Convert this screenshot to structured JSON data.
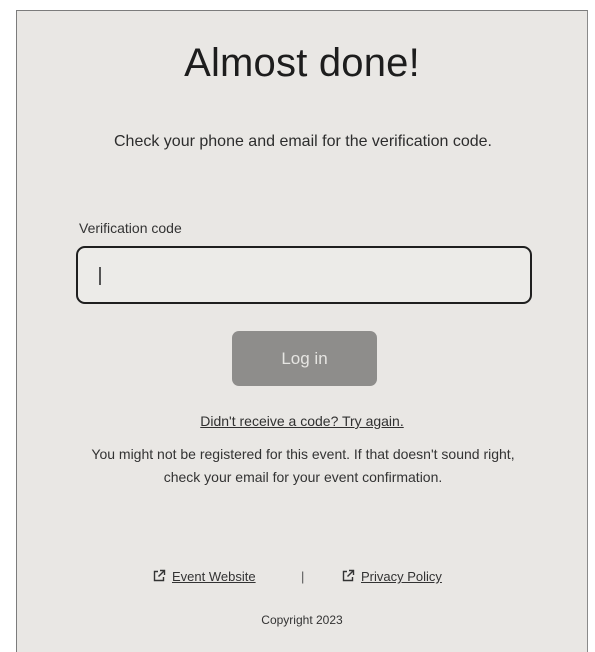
{
  "heading": "Almost done!",
  "subtitle": "Check your phone and email for the verification code.",
  "form": {
    "field_label": "Verification code",
    "field_value": "",
    "field_placeholder": "",
    "submit_label": "Log in"
  },
  "retry_link": "Didn't receive a code? Try again.",
  "notice": "You might not be registered for this event. If that doesn't sound right, check your email for your event confirmation.",
  "footer": {
    "event_website_label": "Event Website",
    "separator": "|",
    "privacy_policy_label": "Privacy Policy",
    "copyright": "Copyright 2023",
    "link_icon": "external-link-icon"
  },
  "colors": {
    "panel_background": "#e9e7e4",
    "button_disabled": "#8e8d8b",
    "input_border": "#1f1f1f"
  }
}
